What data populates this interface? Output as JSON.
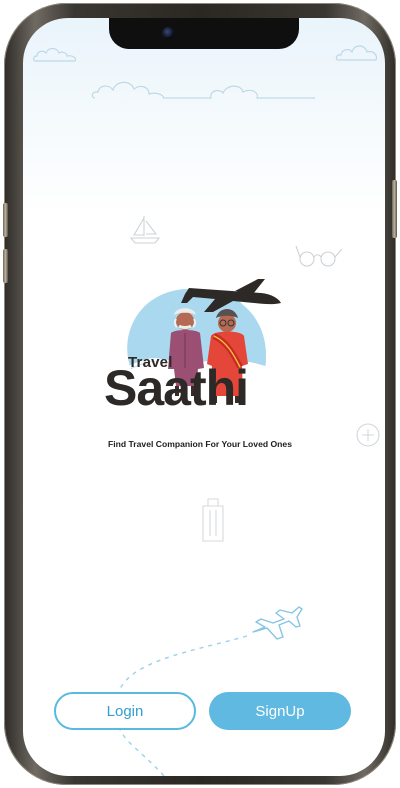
{
  "app": {
    "brand_small": "Travel",
    "brand_large": "Saathi",
    "tagline": "Find Travel Companion For Your Loved Ones"
  },
  "actions": {
    "login_label": "Login",
    "signup_label": "SignUp"
  },
  "colors": {
    "primary": "#5fb9e1",
    "outline": "#5ab9df",
    "brand_text": "#2d2926",
    "sky_badge": "#a9d8ef",
    "companion_male": "#9a4f73",
    "companion_female": "#e4473a"
  },
  "icons": [
    "cloud-icon",
    "sailboat-icon",
    "sunglasses-icon",
    "luggage-icon",
    "coin-icon",
    "airplane-icon",
    "dashed-flight-path"
  ]
}
